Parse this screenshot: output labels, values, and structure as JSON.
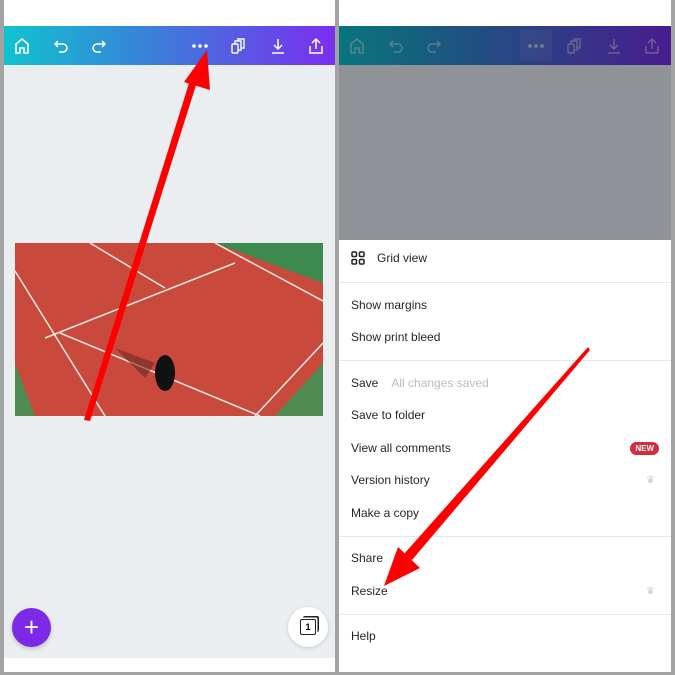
{
  "toolbar": {
    "icons": [
      "home-icon",
      "undo-icon",
      "redo-icon",
      "more-icon",
      "duplicate-icon",
      "download-icon",
      "share-icon"
    ]
  },
  "canvas": {
    "page_count": "1",
    "add_label": "+"
  },
  "menu": {
    "grid_view": "Grid view",
    "show_margins": "Show margins",
    "show_print_bleed": "Show print bleed",
    "save": "Save",
    "save_status": "All changes saved",
    "save_to_folder": "Save to folder",
    "view_all_comments": "View all comments",
    "new_badge": "NEW",
    "version_history": "Version history",
    "make_a_copy": "Make a copy",
    "share": "Share",
    "resize": "Resize",
    "help": "Help"
  },
  "colors": {
    "accent": "#7d2ae8",
    "badge": "#d22c3d",
    "annotation": "#ff0000"
  }
}
